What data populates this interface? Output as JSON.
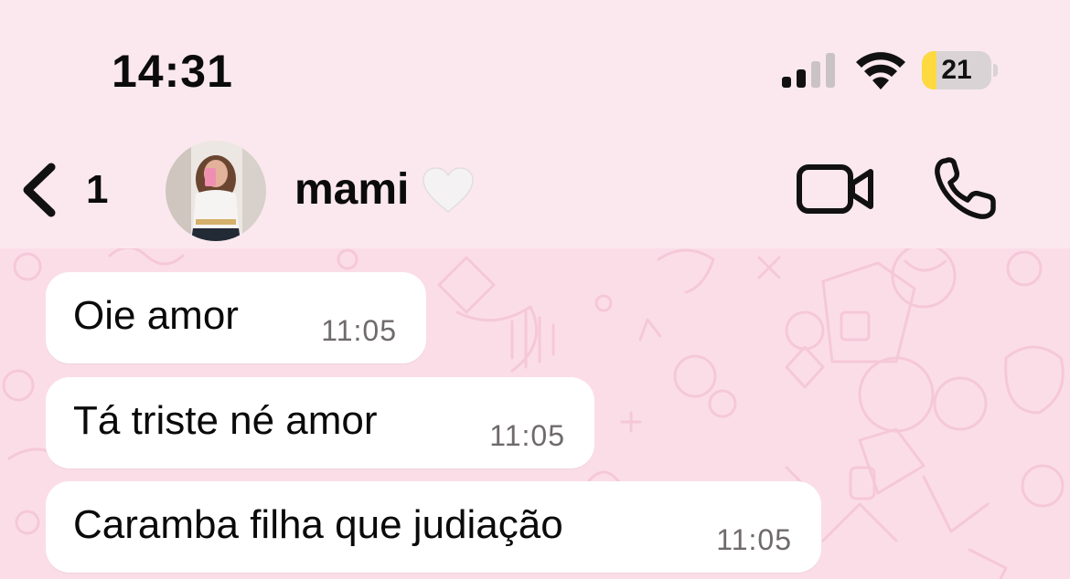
{
  "status_bar": {
    "time": "14:31",
    "battery_level": "21",
    "battery_fraction": 0.21,
    "battery_color": "#ffd940",
    "signal_bars_active": 2,
    "signal_bars_total": 4
  },
  "header": {
    "back_count": "1",
    "contact_name": "mami",
    "name_emoji_icon": "white-heart-icon",
    "video_icon": "video-camera-icon",
    "call_icon": "phone-icon"
  },
  "messages": [
    {
      "text": "Oie amor",
      "time": "11:05"
    },
    {
      "text": "Tá triste né amor",
      "time": "11:05"
    },
    {
      "text": "Caramba filha que judiação",
      "time": "11:05"
    }
  ],
  "colors": {
    "background": "#fbe8ef",
    "chat_wallpaper": "#fbdde8",
    "bubble": "#ffffff",
    "timestamp": "#6f6a6c"
  }
}
